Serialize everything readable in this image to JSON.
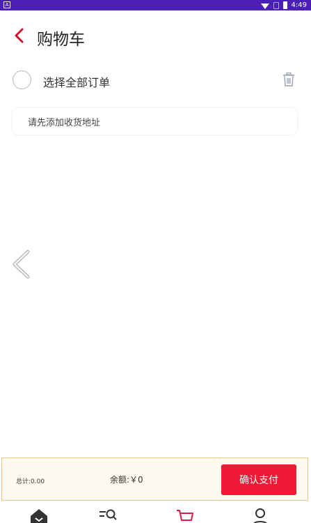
{
  "status_bar": {
    "app_icon_letter": "A",
    "time": "4:49"
  },
  "header": {
    "title": "购物车"
  },
  "select_all": {
    "label": "选择全部订单"
  },
  "address": {
    "prompt": "请先添加收货地址"
  },
  "checkout": {
    "total": "总计:0.00",
    "balance": "余额:￥0",
    "pay_label": "确认支付"
  },
  "colors": {
    "status_bar": "#4b1fb8",
    "accent": "#ee1a36",
    "bar_background": "#fffaf0",
    "bar_border": "#e9c68a"
  },
  "tabbar": {
    "items": [
      {
        "icon": "home-icon",
        "active": false
      },
      {
        "icon": "category-search-icon",
        "active": false
      },
      {
        "icon": "cart-icon",
        "active": true
      },
      {
        "icon": "user-icon",
        "active": false
      }
    ]
  }
}
